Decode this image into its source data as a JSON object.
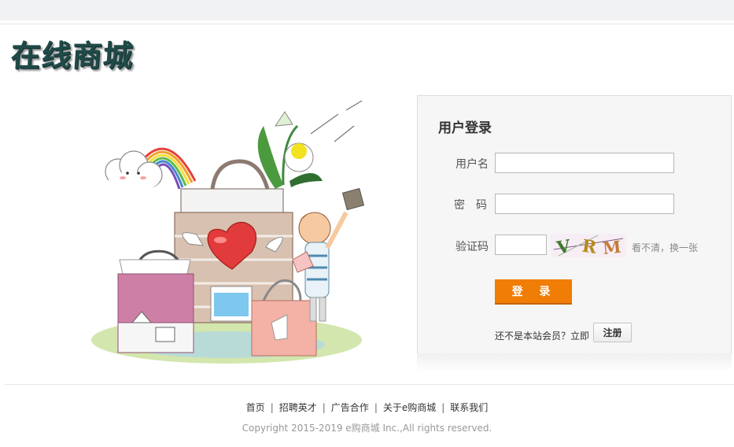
{
  "logo": {
    "text": "在线商城"
  },
  "login": {
    "title": "用户登录",
    "username_label": "用户名",
    "password_label": "密　码",
    "captcha_label": "验证码",
    "captcha_text": "VRM",
    "refresh_link": "看不清，换一张",
    "login_button": "登 录",
    "register_prompt": "还不是本站会员？立即",
    "register_button": "注册"
  },
  "footer": {
    "links": [
      "首页",
      "招聘英才",
      "广告合作",
      "关于e购商城",
      "联系我们"
    ],
    "copyright": "Copyright 2015-2019 e购商城 Inc.,All rights reserved."
  },
  "colors": {
    "accent": "#f07d06",
    "logo": "#1f4a48",
    "panel_bg": "#f6f6f6",
    "topbar": "#f1f2f4"
  }
}
